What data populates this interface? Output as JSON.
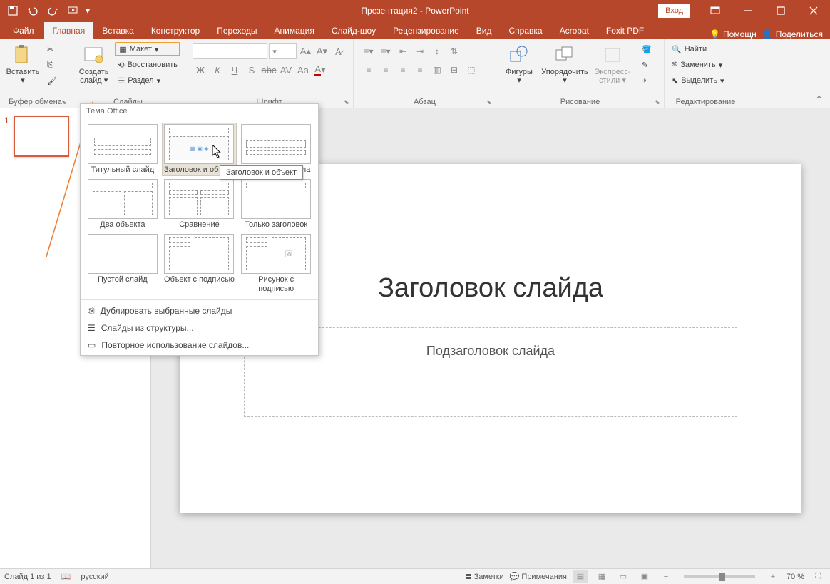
{
  "titlebar": {
    "title": "Презентация2 - PowerPoint",
    "login": "Вход"
  },
  "tabs": {
    "file": "Файл",
    "home": "Главная",
    "insert": "Вставка",
    "design": "Конструктор",
    "transitions": "Переходы",
    "animations": "Анимация",
    "slideshow": "Слайд-шоу",
    "review": "Рецензирование",
    "view": "Вид",
    "help": "Справка",
    "acrobat": "Acrobat",
    "foxit": "Foxit PDF",
    "assist": "Помощн",
    "share": "Поделиться"
  },
  "ribbon": {
    "clipboard": {
      "paste": "Вставить",
      "label": "Буфер обмена"
    },
    "slides": {
      "new_slide": "Создать слайд",
      "layout": "Макет",
      "reset": "Восстановить",
      "section": "Раздел",
      "label": "Слайды"
    },
    "font": {
      "label": "Шрифт"
    },
    "paragraph": {
      "label": "Абзац"
    },
    "drawing": {
      "shapes": "Фигуры",
      "arrange": "Упорядочить",
      "quick_styles": "Экспресс-стили",
      "label": "Рисование"
    },
    "editing": {
      "find": "Найти",
      "replace": "Заменить",
      "select": "Выделить",
      "label": "Редактирование"
    }
  },
  "gallery": {
    "header": "Тема Office",
    "layouts": {
      "title_slide": "Титульный слайд",
      "title_content": "Заголовок и объект",
      "section_header": "Заголовок раздела",
      "two_content": "Два объекта",
      "comparison": "Сравнение",
      "title_only": "Только заголовок",
      "blank": "Пустой слайд",
      "content_caption": "Объект с подписью",
      "picture_caption": "Рисунок с подписью"
    },
    "menu": {
      "duplicate": "Дублировать выбранные слайды",
      "from_outline": "Слайды из структуры...",
      "reuse": "Повторное использование слайдов..."
    },
    "tooltip": "Заголовок и объект"
  },
  "slide": {
    "title_placeholder": "Заголовок слайда",
    "subtitle_placeholder": "Подзаголовок слайда"
  },
  "statusbar": {
    "slide_count": "Слайд 1 из 1",
    "language": "русский",
    "notes": "Заметки",
    "comments": "Примечания",
    "zoom": "70 %"
  },
  "thumbs": {
    "num1": "1"
  }
}
